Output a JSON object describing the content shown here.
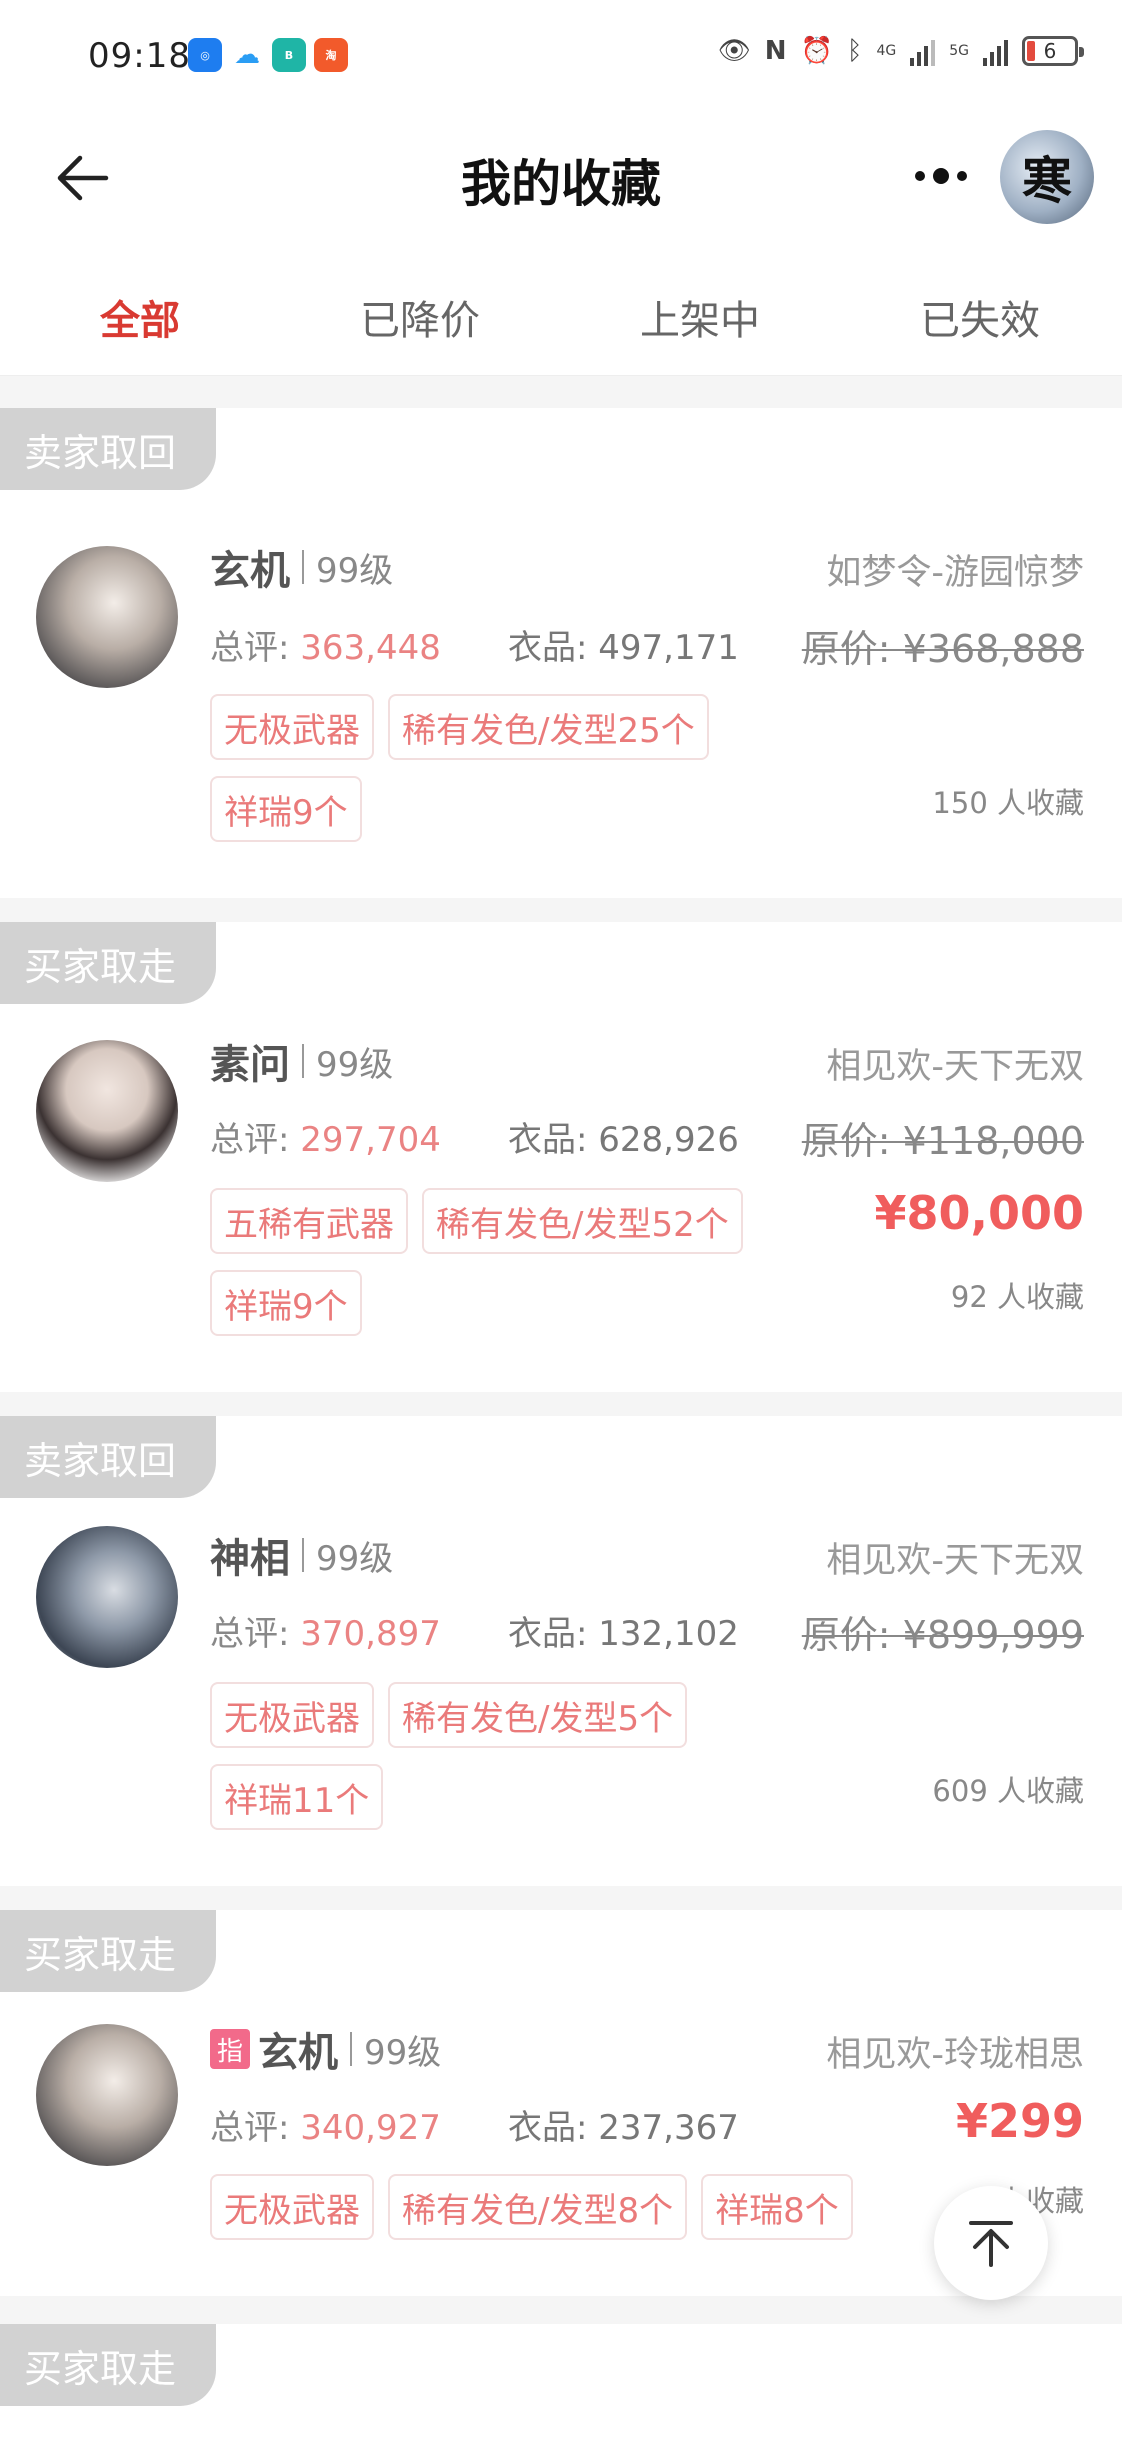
{
  "status_bar": {
    "time": "09:18",
    "battery": "6",
    "net1": "4G",
    "net2": "5G"
  },
  "nav": {
    "title": "我的收藏"
  },
  "tabs": [
    {
      "label": "全部",
      "active": true
    },
    {
      "label": "已降价",
      "active": false
    },
    {
      "label": "上架中",
      "active": false
    },
    {
      "label": "已失效",
      "active": false
    }
  ],
  "cards": [
    {
      "status": "卖家取回",
      "name": "玄机",
      "level": "99级",
      "server": "如梦令-游园惊梦",
      "score_label": "总评: ",
      "score": "363,448",
      "cloth": "衣品: 497,171",
      "original_price": "原价: ¥368,888",
      "price": "",
      "tags": [
        "无极武器",
        "稀有发色/发型25个",
        "祥瑞9个"
      ],
      "favorites": "150 人收藏"
    },
    {
      "status": "买家取走",
      "name": "素问",
      "level": "99级",
      "server": "相见欢-天下无双",
      "score_label": "总评: ",
      "score": "297,704",
      "cloth": "衣品: 628,926",
      "original_price": "原价: ¥118,000",
      "price": "¥80,000",
      "tags": [
        "五稀有武器",
        "稀有发色/发型52个",
        "祥瑞9个"
      ],
      "favorites": "92 人收藏"
    },
    {
      "status": "卖家取回",
      "name": "神相",
      "level": "99级",
      "server": "相见欢-天下无双",
      "score_label": "总评: ",
      "score": "370,897",
      "cloth": "衣品: 132,102",
      "original_price": "原价: ¥899,999",
      "price": "",
      "tags": [
        "无极武器",
        "稀有发色/发型5个",
        "祥瑞11个"
      ],
      "favorites": "609 人收藏"
    },
    {
      "status": "买家取走",
      "badge": "指",
      "name": "玄机",
      "level": "99级",
      "server": "相见欢-玲珑相思",
      "score_label": "总评: ",
      "score": "340,927",
      "cloth": "衣品: 237,367",
      "original_price": "",
      "price": "¥299",
      "tags": [
        "无极武器",
        "稀有发色/发型8个",
        "祥瑞8个"
      ],
      "favorites": "人收藏"
    },
    {
      "status": "买家取走"
    }
  ],
  "colors": {
    "accent": "#d93a32",
    "price": "#f05d5d",
    "tag_text": "#ea7a7a",
    "status_label_bg": "#d2d2d2"
  },
  "icons": [
    "back-arrow-icon",
    "more-icon",
    "back-to-top-icon"
  ]
}
